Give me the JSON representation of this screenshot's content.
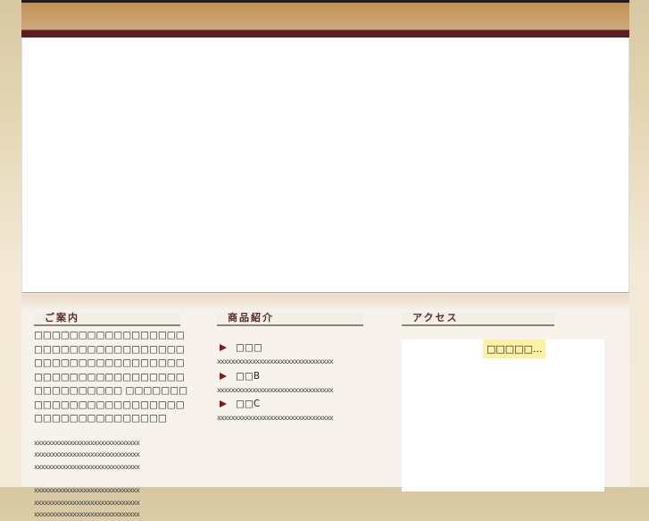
{
  "guide": {
    "heading": "ご案内",
    "paragraph": "□□□□□□□□□□□□□□□□□□□□□□□□□□□□□□□□□□ □□□□□□□□□□□□□□□□□□□□□□□□□□□□□□□□□□□□□□□□□□□□ □□□□□□□□□□□□□□□□□□□□□□□□□□□□□□□□□□□□□□□",
    "x_lines_1": [
      "xxxxxxxxxxxxxxxxxxxxxxxxxxxxxx",
      "xxxxxxxxxxxxxxxxxxxxxxxxxxxxxx",
      "xxxxxxxxxxxxxxxxxxxxxxxxxxxxxx"
    ],
    "x_lines_2": [
      "xxxxxxxxxxxxxxxxxxxxxxxxxxxxxx",
      "xxxxxxxxxxxxxxxxxxxxxxxxxxxxxx",
      "xxxxxxxxxxxxxxxxxxxxxxxxxxxxxx"
    ]
  },
  "products": {
    "heading": "商品紹介",
    "items": [
      {
        "label": "□□□",
        "desc": "xxxxxxxxxxxxxxxxxxxxxxxxxxxxxxxxx"
      },
      {
        "label": "□□B",
        "desc": "xxxxxxxxxxxxxxxxxxxxxxxxxxxxxxxxx"
      },
      {
        "label": "□□C",
        "desc": "xxxxxxxxxxxxxxxxxxxxxxxxxxxxxxxxx"
      }
    ]
  },
  "access": {
    "heading": "アクセス",
    "loading": "□□□□□..."
  }
}
